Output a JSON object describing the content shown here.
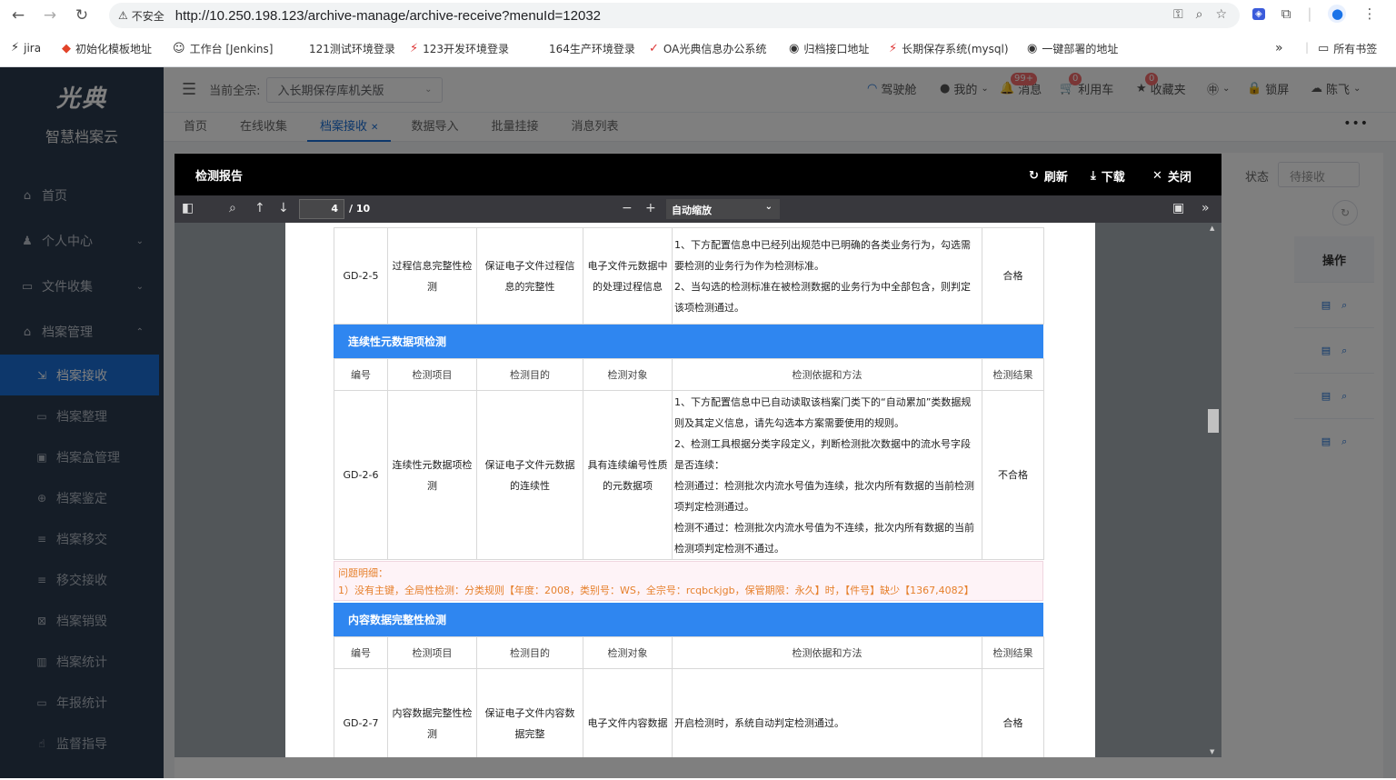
{
  "browser": {
    "security_label": "不安全",
    "url": "http://10.250.198.123/archive-manage/archive-receive?menuId=12032",
    "bookmarks": [
      "jira",
      "初始化模板地址",
      "工作台 [Jenkins]",
      "121测试环境登录",
      "123开发环境登录",
      "164生产环境登录",
      "OA光典信息办公系统",
      "归档接口地址",
      "长期保存系统(mysql)",
      "一键部署的地址"
    ],
    "all_bookmarks": "所有书签"
  },
  "sidebar": {
    "logo_text": "光典",
    "subtitle": "智慧档案云",
    "items": [
      {
        "label": "首页"
      },
      {
        "label": "个人中心"
      },
      {
        "label": "文件收集"
      },
      {
        "label": "档案管理"
      }
    ],
    "sub_items": [
      "档案接收",
      "档案整理",
      "档案盒管理",
      "档案鉴定",
      "档案移交",
      "移交接收",
      "档案销毁",
      "档案统计",
      "年报统计",
      "监督指导"
    ]
  },
  "topbar": {
    "qz_label": "当前全宗:",
    "qz_value": "入长期保存库机关版",
    "cockpit": "驾驶舱",
    "mine": "我的",
    "msg": "消息",
    "msg_badge": "99+",
    "borrow": "利用车",
    "borrow_badge": "0",
    "fav": "收藏夹",
    "fav_badge": "0",
    "lock": "锁屏",
    "user": "陈飞"
  },
  "tabs": [
    "首页",
    "在线收集",
    "档案接收",
    "数据导入",
    "批量挂接",
    "消息列表"
  ],
  "background": {
    "status_label": "状态",
    "status_value": "待接收",
    "op_header": "操作"
  },
  "modal": {
    "title": "检测报告",
    "refresh": "刷新",
    "download": "下载",
    "close": "关闭"
  },
  "pdf": {
    "page": "4",
    "page_count": "/ 10",
    "zoom": "自动缩放"
  },
  "report": {
    "row_a": {
      "code": "GD-2-5",
      "item": "过程信息完整性检测",
      "purpose": "保证电子文件过程信息的完整性",
      "object": "电子文件元数据中的处理过程信息",
      "basis_1": "1、下方配置信息中已经列出规范中已明确的各类业务行为，勾选需要检测的业务行为作为检测标准。",
      "basis_2": "2、当勾选的检测标准在被检测数据的业务行为中全部包含，则判定该项检测通过。",
      "result": "合格"
    },
    "section_1": "连续性元数据项检测",
    "headers": [
      "编号",
      "检测项目",
      "检测目的",
      "检测对象",
      "检测依据和方法",
      "检测结果"
    ],
    "row_b": {
      "code": "GD-2-6",
      "item": "连续性元数据项检测",
      "purpose": "保证电子文件元数据的连续性",
      "object": "具有连续编号性质的元数据项",
      "basis_1": "1、下方配置信息中已自动读取该档案门类下的“自动累加”类数据规则及其定义信息，请先勾选本方案需要使用的规则。",
      "basis_2": "2、检测工具根据分类字段定义，判断检测批次数据中的流水号字段是否连续：",
      "basis_3": "检测通过：检测批次内流水号值为连续，批次内所有数据的当前检测项判定检测通过。",
      "basis_4": "检测不通过：检测批次内流水号值为不连续，批次内所有数据的当前检测项判定检测不通过。",
      "result": "不合格"
    },
    "problem_title": "问题明细：",
    "problem_text": "1）没有主键，全局性检测：分类规则【年度：2008，类别号：WS，全宗号：rcqbckjgb，保管期限：永久】时，【件号】缺少【1367,4082】",
    "section_2": "内容数据完整性检测",
    "row_c": {
      "code": "GD-2-7",
      "item": "内容数据完整性检测",
      "purpose": "保证电子文件内容数据完整",
      "object": "电子文件内容数据",
      "basis_1": "开启检测时，系统自动判定检测通过。",
      "result": "合格"
    }
  }
}
